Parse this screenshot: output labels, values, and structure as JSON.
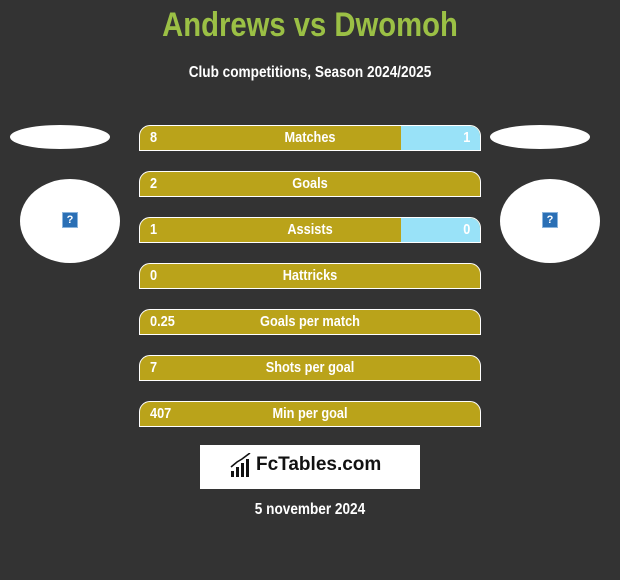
{
  "header": {
    "title": "Andrews vs Dwomoh",
    "subtitle": "Club competitions, Season 2024/2025"
  },
  "players": {
    "left": {
      "name": "Andrews",
      "avatar_icon": "missing-image-icon",
      "avatar_glyph": "?"
    },
    "right": {
      "name": "Dwomoh",
      "avatar_icon": "missing-image-icon",
      "avatar_glyph": "?"
    }
  },
  "stats": [
    {
      "label": "Matches",
      "left": "8",
      "right": "1",
      "has_right": true
    },
    {
      "label": "Goals",
      "left": "2",
      "right": "",
      "has_right": false
    },
    {
      "label": "Assists",
      "left": "1",
      "right": "0",
      "has_right": true
    },
    {
      "label": "Hattricks",
      "left": "0",
      "right": "",
      "has_right": false
    },
    {
      "label": "Goals per match",
      "left": "0.25",
      "right": "",
      "has_right": false
    },
    {
      "label": "Shots per goal",
      "left": "7",
      "right": "",
      "has_right": false
    },
    {
      "label": "Min per goal",
      "left": "407",
      "right": "",
      "has_right": false
    }
  ],
  "colors": {
    "background": "#333333",
    "title": "#9bc045",
    "left_bar": "#baa31a",
    "right_bar": "#99e2f8"
  },
  "footer": {
    "logo_text": "FcTables.com",
    "logo_icon": "bar-chart-icon",
    "date": "5 november 2024"
  }
}
